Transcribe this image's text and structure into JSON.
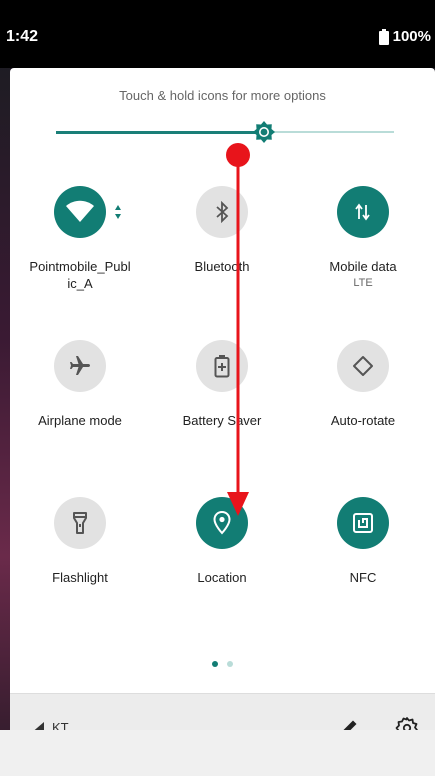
{
  "status_bar": {
    "time": "1:42",
    "battery": "100%"
  },
  "quick_settings": {
    "hint": "Touch & hold icons for more options",
    "brightness_fraction": 0.62,
    "tiles": [
      {
        "label": "Pointmobile_Public_A",
        "label_line1": "Pointmobile_Publ",
        "label_line2": "ic_A",
        "sub": "",
        "state": "on",
        "icon": "wifi-icon"
      },
      {
        "label": "Bluetooth",
        "sub": "",
        "state": "off",
        "icon": "bluetooth-icon"
      },
      {
        "label": "Mobile data",
        "sub": "LTE",
        "state": "on",
        "icon": "mobile-data-icon"
      },
      {
        "label": "Airplane mode",
        "sub": "",
        "state": "off",
        "icon": "airplane-icon"
      },
      {
        "label": "Battery Saver",
        "sub": "",
        "state": "off",
        "icon": "battery-saver-icon"
      },
      {
        "label": "Auto-rotate",
        "sub": "",
        "state": "off",
        "icon": "auto-rotate-icon"
      },
      {
        "label": "Flashlight",
        "sub": "",
        "state": "off",
        "icon": "flashlight-icon"
      },
      {
        "label": "Location",
        "sub": "",
        "state": "on",
        "icon": "location-icon"
      },
      {
        "label": "NFC",
        "sub": "",
        "state": "on",
        "icon": "nfc-icon"
      }
    ],
    "page_indicator": {
      "current": 1,
      "total": 2
    }
  },
  "footer": {
    "carrier": "KT"
  },
  "colors": {
    "accent": "#127d74",
    "tile_off": "#e2e2e2",
    "gesture_arrow": "#e8141b"
  }
}
